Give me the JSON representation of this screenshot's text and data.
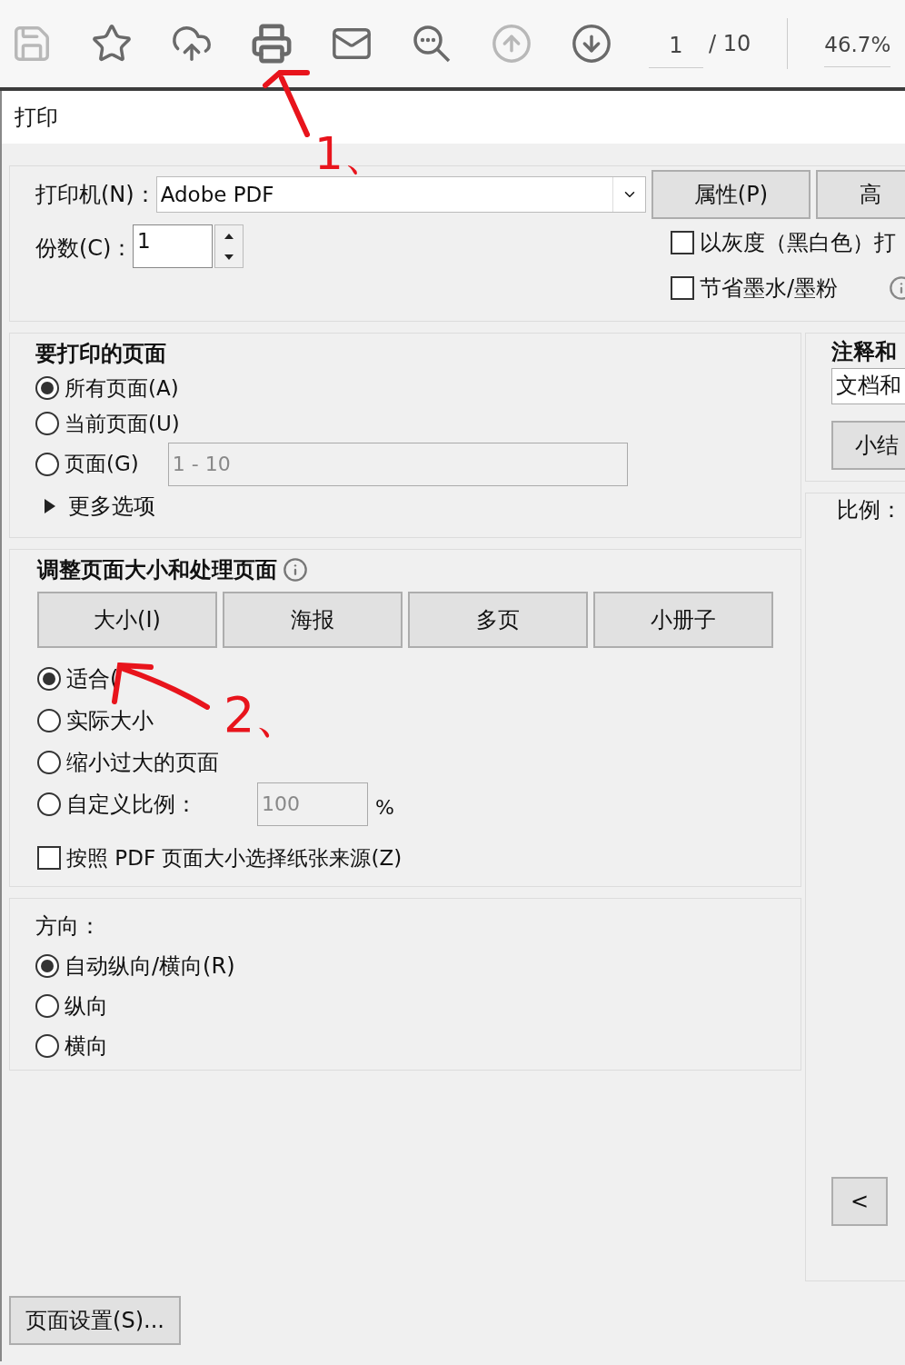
{
  "toolbar": {
    "tools": [
      {
        "kind": "save",
        "disabled": true
      },
      {
        "kind": "star",
        "disabled": false
      },
      {
        "kind": "upload",
        "disabled": false
      },
      {
        "kind": "print",
        "disabled": false
      },
      {
        "kind": "mail",
        "disabled": false
      },
      {
        "kind": "search",
        "disabled": false
      },
      {
        "kind": "up",
        "disabled": true
      },
      {
        "kind": "down",
        "disabled": false
      }
    ],
    "page": "1",
    "page_total": "/ 10",
    "zoom": "46.7%"
  },
  "dialog": {
    "title": "打印",
    "printer": {
      "label": "打印机(N)：",
      "value": "Adobe PDF",
      "properties_button": "属性(P)",
      "advanced_button": "高"
    },
    "copies": {
      "label": "份数(C)：",
      "value": "1"
    },
    "options": [
      {
        "label": "以灰度（黑白色）打",
        "checked": false
      },
      {
        "label": "节省墨水/墨粉",
        "checked": false
      }
    ],
    "pages": {
      "title": "要打印的页面",
      "radios": [
        {
          "label": "所有页面(A)",
          "selected": true
        },
        {
          "label": "当前页面(U)",
          "selected": false
        },
        {
          "label": "页面(G)",
          "selected": false
        }
      ],
      "range": "1 - 10",
      "more": "更多选项"
    },
    "sizing": {
      "title": "调整页面大小和处理页面",
      "tabs": [
        "大小(I)",
        "海报",
        "多页",
        "小册子"
      ],
      "radios": [
        {
          "label": "适合(",
          "selected": true
        },
        {
          "label": "实际大小",
          "selected": false
        },
        {
          "label": "缩小过大的页面",
          "selected": false
        },
        {
          "label": "自定义比例：",
          "selected": false
        }
      ],
      "custom_value": "100",
      "percent": "%",
      "paper_source": {
        "label": "按照 PDF 页面大小选择纸张来源(Z)",
        "checked": false
      }
    },
    "orientation": {
      "title": "方向：",
      "radios": [
        {
          "label": "自动纵向/横向(R)",
          "selected": true
        },
        {
          "label": "纵向",
          "selected": false
        },
        {
          "label": "横向",
          "selected": false
        }
      ]
    },
    "comments": {
      "title": "注释和",
      "value": "文档和",
      "summary_button": "小结"
    },
    "scale_label": "比例：",
    "prev_button": "<",
    "page_setup_button": "页面设置(S)..."
  },
  "annotations": [
    "1、",
    "2、"
  ]
}
